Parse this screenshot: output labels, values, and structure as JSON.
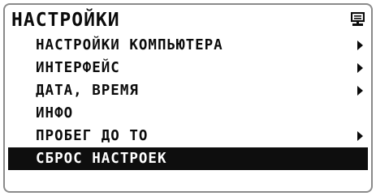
{
  "header": {
    "title": "НАСТРОЙКИ",
    "icon": "computer-monitor-icon"
  },
  "menu": {
    "items": [
      {
        "label": "НАСТРОЙКИ КОМПЬЮТЕРА",
        "has_submenu": true,
        "selected": false
      },
      {
        "label": "ИНТЕРФЕЙС",
        "has_submenu": true,
        "selected": false
      },
      {
        "label": "ДАТА, ВРЕМЯ",
        "has_submenu": true,
        "selected": false
      },
      {
        "label": "ИНФО",
        "has_submenu": false,
        "selected": false
      },
      {
        "label": "ПРОБЕГ ДО ТО",
        "has_submenu": true,
        "selected": false
      },
      {
        "label": "СБРОС НАСТРОЕК",
        "has_submenu": false,
        "selected": true
      }
    ]
  },
  "colors": {
    "foreground": "#0b0b0b",
    "selection_background": "#0e0e0e",
    "selection_text": "#ffffff",
    "frame": "#8a8a8a"
  }
}
